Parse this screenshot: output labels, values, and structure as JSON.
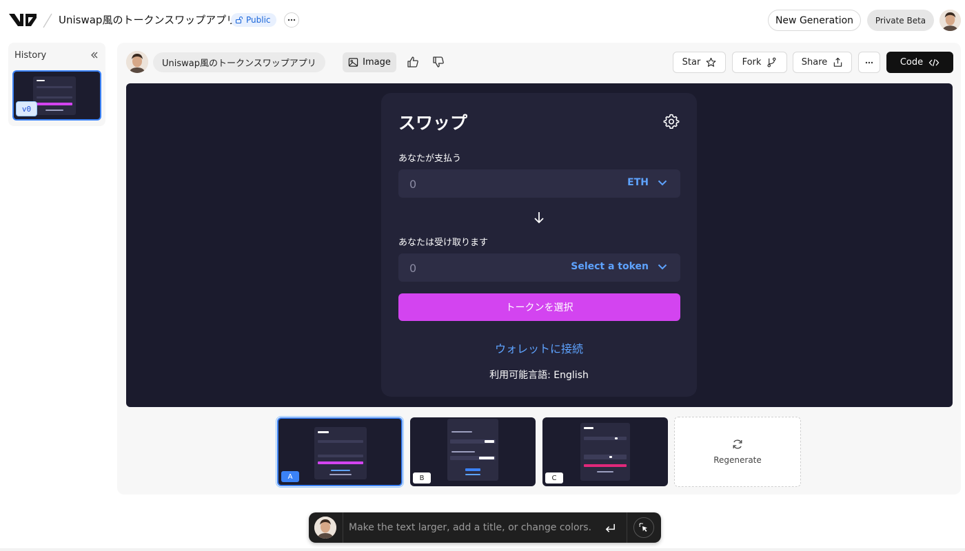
{
  "header": {
    "app_title": "Uniswap風のトークンスワップアプリ",
    "visibility": "Public",
    "new_generation_label": "New Generation",
    "private_beta_label": "Private Beta"
  },
  "history": {
    "title": "History",
    "versions": [
      {
        "label": "v0"
      }
    ]
  },
  "toolbar": {
    "prompt": "Uniswap風のトークンスワップアプリ",
    "image_label": "Image",
    "star_label": "Star",
    "fork_label": "Fork",
    "share_label": "Share",
    "code_label": "Code"
  },
  "swap": {
    "title": "スワップ",
    "pay_label": "あなたが支払う",
    "pay_amount_placeholder": "0",
    "pay_token": "ETH",
    "receive_label": "あなたは受け取ります",
    "receive_amount_placeholder": "0",
    "receive_token": "Select a token",
    "select_button": "トークンを選択",
    "wallet_link": "ウォレットに接続",
    "language_text": "利用可能言語: English"
  },
  "variants": [
    {
      "label": "A",
      "selected": true
    },
    {
      "label": "B",
      "selected": false
    },
    {
      "label": "C",
      "selected": false
    }
  ],
  "regenerate_label": "Regenerate",
  "chat": {
    "placeholder": "Make the text larger, add a title, or change colors."
  },
  "colors": {
    "preview_bg": "#1b1b2d",
    "card_bg": "#232338",
    "accent_pink": "#d344f0",
    "link_blue": "#5ea3ff",
    "selected_blue": "#3b82f6"
  }
}
